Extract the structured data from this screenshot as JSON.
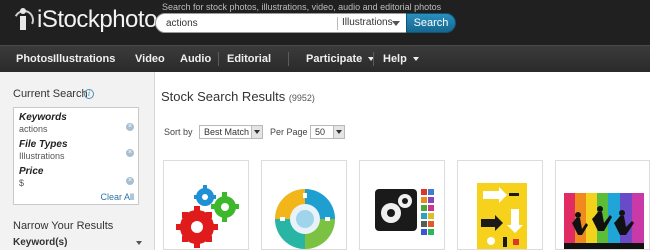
{
  "header": {
    "logo_text": "iStockphoto",
    "search_caption": "Search for stock photos, illustrations, video, audio and editorial photos",
    "search_value": "actions",
    "search_type": "Illustrations",
    "search_button": "Search"
  },
  "nav": {
    "photos": "Photos",
    "illustrations": "Illustrations",
    "video": "Video",
    "audio": "Audio",
    "editorial": "Editorial",
    "participate": "Participate",
    "help": "Help"
  },
  "sidebar": {
    "current_search": "Current Search",
    "filters": [
      {
        "label": "Keywords",
        "value": "actions"
      },
      {
        "label": "File Types",
        "value": "Illustrations"
      },
      {
        "label": "Price",
        "value": "$"
      }
    ],
    "clear_all": "Clear All",
    "narrow": "Narrow Your Results",
    "keywords_section": "Keyword(s)"
  },
  "main": {
    "title": "Stock Search Results",
    "count": "(9952)",
    "sort_label": "Sort by",
    "sort_value": "Best Match",
    "per_page_label": "Per Page",
    "per_page_value": "50"
  },
  "thumbnails": [
    {
      "subject": "gears-illustration"
    },
    {
      "subject": "circular-diagram-illustration"
    },
    {
      "subject": "gear-app-icons-illustration"
    },
    {
      "subject": "yellow-action-arrows-illustration"
    },
    {
      "subject": "jumping-silhouettes-illustration"
    }
  ],
  "colors": {
    "header_bg": "#202020",
    "accent_blue": "#1a7aa8",
    "sidebar_bg": "#f2f2f2"
  }
}
